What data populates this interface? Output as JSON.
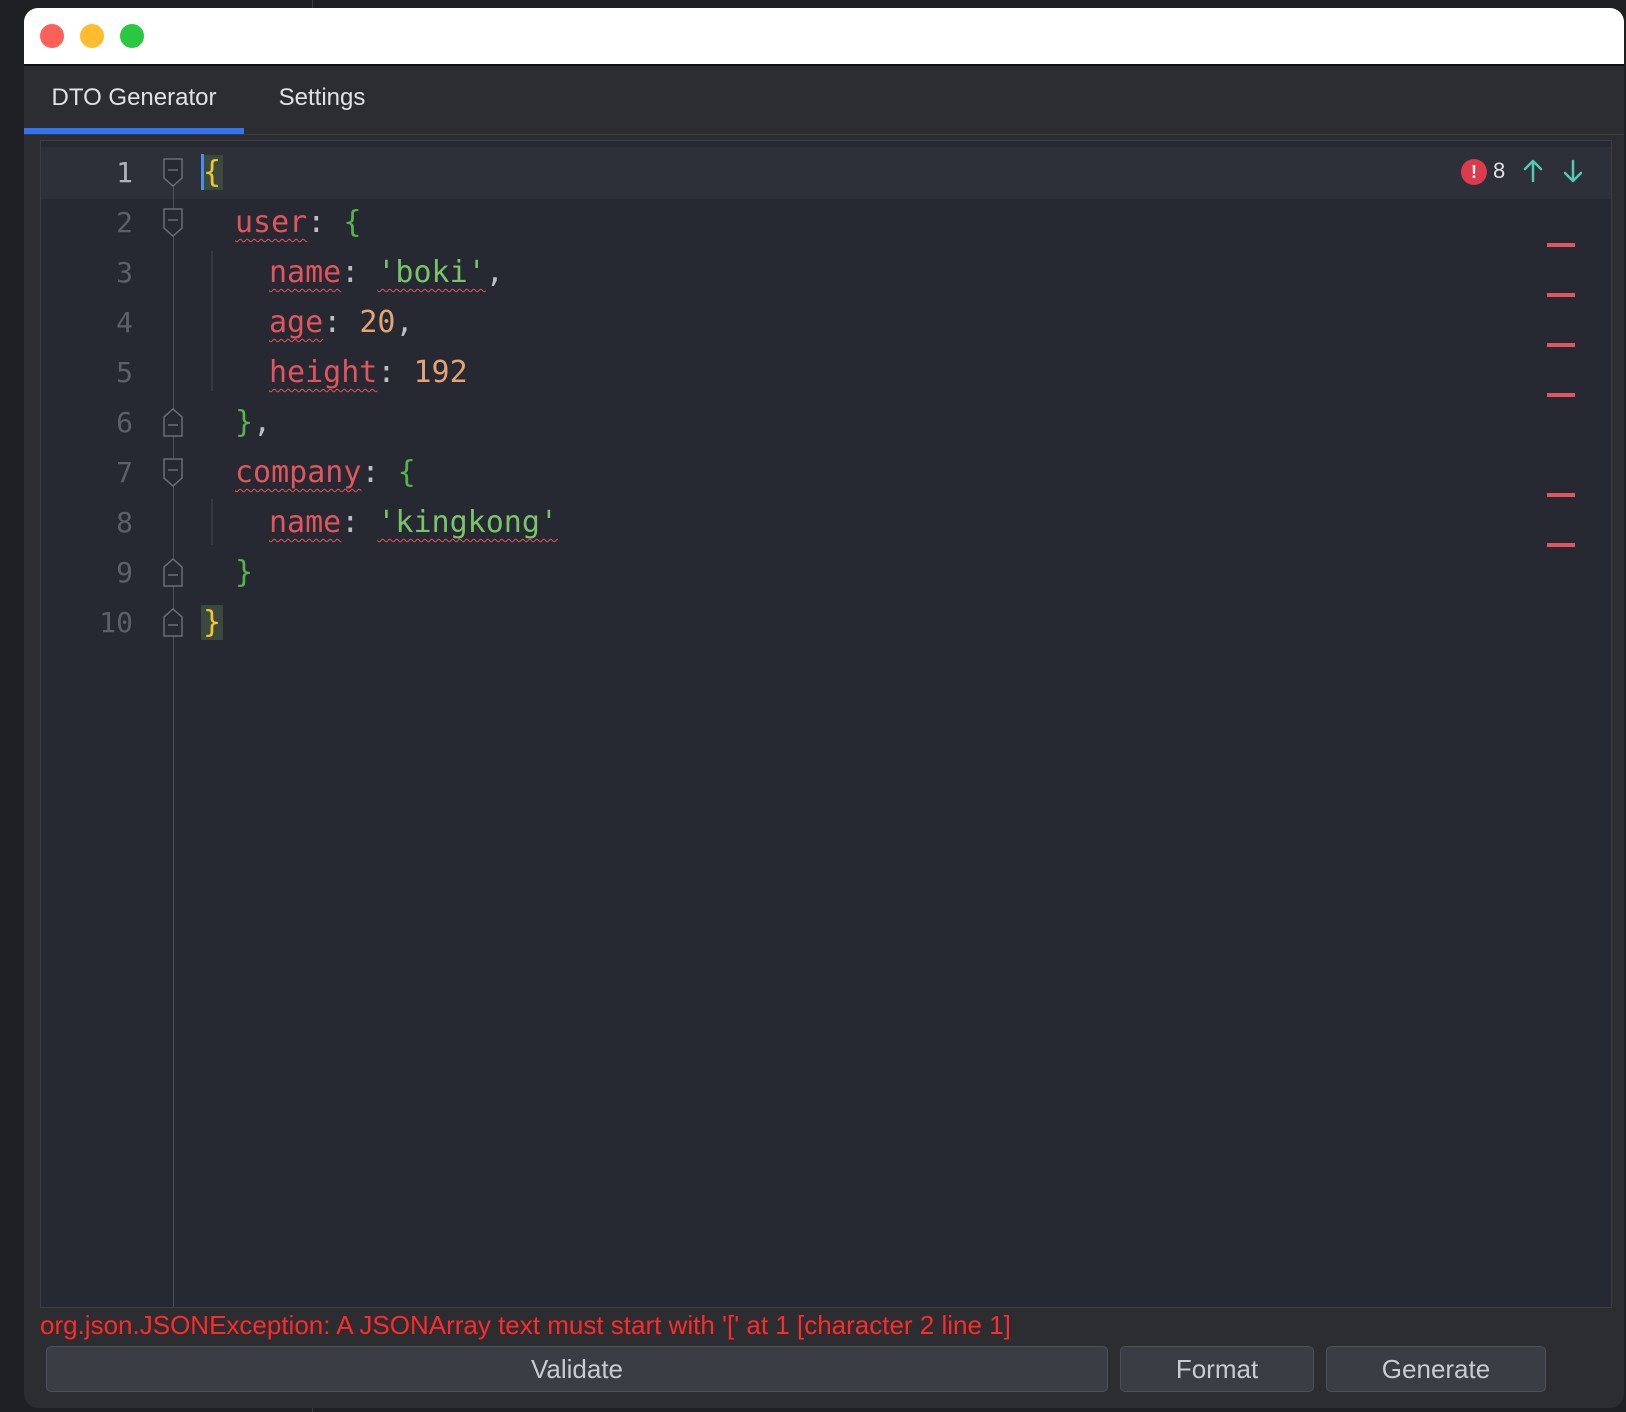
{
  "tabs": [
    {
      "label": "DTO Generator",
      "active": true
    },
    {
      "label": "Settings",
      "active": false
    }
  ],
  "editor": {
    "line_numbers": [
      "1",
      "2",
      "3",
      "4",
      "5",
      "6",
      "7",
      "8",
      "9",
      "10"
    ],
    "tokens": {
      "l1_open": "{",
      "l2_key": "user",
      "l2_colon": ": ",
      "l2_open": "{",
      "l3_key": "name",
      "l3_colon": ": ",
      "l3_val": "'boki'",
      "l3_comma": ",",
      "l4_key": "age",
      "l4_colon": ": ",
      "l4_val": "20",
      "l4_comma": ",",
      "l5_key": "height",
      "l5_colon": ": ",
      "l5_val": "192",
      "l6_close": "}",
      "l6_comma": ",",
      "l7_key": "company",
      "l7_colon": ": ",
      "l7_open": "{",
      "l8_key": "name",
      "l8_colon": ": ",
      "l8_val": "'kingkong'",
      "l9_close": "}",
      "l10_close": "}"
    },
    "inspection": {
      "error_icon": "!",
      "error_count": "8",
      "prev_icon": "arrow-up-icon",
      "next_icon": "arrow-down-icon"
    }
  },
  "status_message": "org.json.JSONException: A JSONArray text must start with '[' at 1 [character 2 line 1]",
  "buttons": {
    "validate": "Validate",
    "format": "Format",
    "generate": "Generate"
  },
  "colors": {
    "accent": "#3574f0",
    "error": "#ff2a2a",
    "key": "#e0555e",
    "string": "#79c46b",
    "number": "#e3a474",
    "brace": "#56b34d",
    "outer_brace": "#f4c430"
  }
}
